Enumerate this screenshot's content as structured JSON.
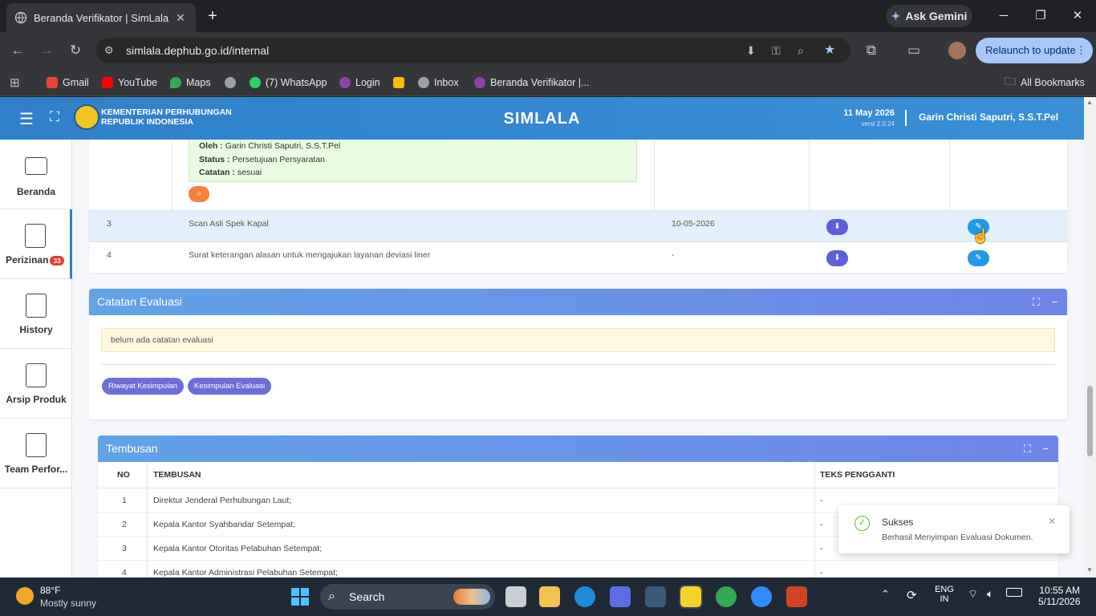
{
  "browser": {
    "tab_title": "Beranda Verifikator | SimLala",
    "ask_gemini": "Ask Gemini",
    "url": "simlala.dephub.go.id/internal",
    "relaunch": "Relaunch to update",
    "bookmarks": [
      {
        "label": "Gmail",
        "color": "#ea4335"
      },
      {
        "label": "YouTube",
        "color": "#ff0000"
      },
      {
        "label": "Maps",
        "color": "#34a853"
      },
      {
        "label": "",
        "color": "#9aa0a6"
      },
      {
        "label": "(7) WhatsApp",
        "color": "#25d366"
      },
      {
        "label": "Login",
        "color": "#8e44ad"
      },
      {
        "label": "",
        "color": "#fbbc04"
      },
      {
        "label": "Inbox",
        "color": "#9aa0a6"
      },
      {
        "label": "Beranda Verifikator |...",
        "color": "#8e44ad"
      }
    ],
    "all_bookmarks": "All Bookmarks"
  },
  "header": {
    "ministry_line1": "KEMENTERIAN PERHUBUNGAN",
    "ministry_line2": "REPUBLIK INDONESIA",
    "brand": "SIMLALA",
    "date": "11 May 2026",
    "version": "versi 2.0.24",
    "user": "Garin Christi Saputri, S.S.T.Pel"
  },
  "sidebar": {
    "items": [
      {
        "label": "Beranda",
        "badge": ""
      },
      {
        "label": "Perizinan",
        "badge": "33"
      },
      {
        "label": "History",
        "badge": ""
      },
      {
        "label": "Arsip Produk",
        "badge": ""
      },
      {
        "label": "Team Perfor...",
        "badge": ""
      }
    ]
  },
  "docs": {
    "note": {
      "oleh_label": "Oleh :",
      "oleh_value": "Garin Christi Saputri, S.S.T.Pel",
      "status_label": "Status :",
      "status_value": "Persetujuan Persyaratan",
      "catatan_label": "Catatan :",
      "catatan_value": "sesuai"
    },
    "rows": [
      {
        "no": "3",
        "name": "Scan Asli Spek Kapal",
        "date": "10-05-2026"
      },
      {
        "no": "4",
        "name": "Surat keterangan alasan untuk mengajukan layanan deviasi liner",
        "date": "-"
      }
    ]
  },
  "evaluasi": {
    "title": "Catatan Evaluasi",
    "empty_note": "belum ada catatan evaluasi",
    "btn_riwayat": "Riwayat Kesimpulan",
    "btn_kesimpulan": "Kesimpulan Evaluasi"
  },
  "tembusan": {
    "title": "Tembusan",
    "headers": [
      "NO",
      "TEMBUSAN",
      "TEKS PENGGANTI"
    ],
    "rows": [
      {
        "no": "1",
        "name": "Direktur Jenderal Perhubungan Laut;",
        "teks": "-"
      },
      {
        "no": "2",
        "name": "Kepala Kantor Syahbandar Setempat;",
        "teks": "-"
      },
      {
        "no": "3",
        "name": "Kepala Kantor Otoritas Pelabuhan Setempat;",
        "teks": "-"
      },
      {
        "no": "4",
        "name": "Kepala Kantor Administrasi Pelabuhan Setempat;",
        "teks": "-"
      }
    ]
  },
  "toast": {
    "title": "Sukses",
    "message": "Berhasil Menyimpan Evaluasi Dokumen."
  },
  "taskbar": {
    "temp": "88°F",
    "weather": "Mostly sunny",
    "search": "Search",
    "lang1": "ENG",
    "lang2": "IN",
    "time": "10:55 AM",
    "date": "5/11/2026"
  }
}
